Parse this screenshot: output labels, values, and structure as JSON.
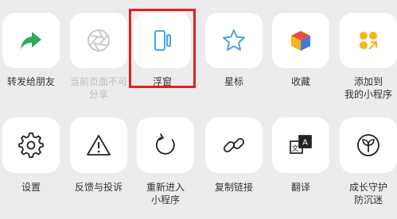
{
  "accent_highlight_color": "#e02020",
  "row1": [
    {
      "label": "转发给朋友",
      "icon": "share-arrow-icon",
      "color": "#2daa5a"
    },
    {
      "label": "当前页面不可\n分享",
      "icon": "aperture-icon",
      "color": "#c8c8c8",
      "disabled": true
    },
    {
      "label": "浮窗",
      "icon": "floating-window-icon",
      "color": "#4aa3e6"
    },
    {
      "label": "星标",
      "icon": "star-icon",
      "color": "#4aa3e6"
    },
    {
      "label": "收藏",
      "icon": "favorites-cube-icon",
      "color": "#e84d3d"
    },
    {
      "label": "添加到\n我的小程序",
      "icon": "mini-program-dots-icon",
      "color": "#f5b51e"
    }
  ],
  "row2": [
    {
      "label": "设置",
      "icon": "gear-icon"
    },
    {
      "label": "反馈与投诉",
      "icon": "warning-triangle-icon"
    },
    {
      "label": "重新进入\n小程序",
      "icon": "refresh-icon"
    },
    {
      "label": "复制链接",
      "icon": "link-icon"
    },
    {
      "label": "翻译",
      "icon": "translate-icon"
    },
    {
      "label": "成长守护\n防沉迷",
      "icon": "sprout-icon"
    }
  ]
}
